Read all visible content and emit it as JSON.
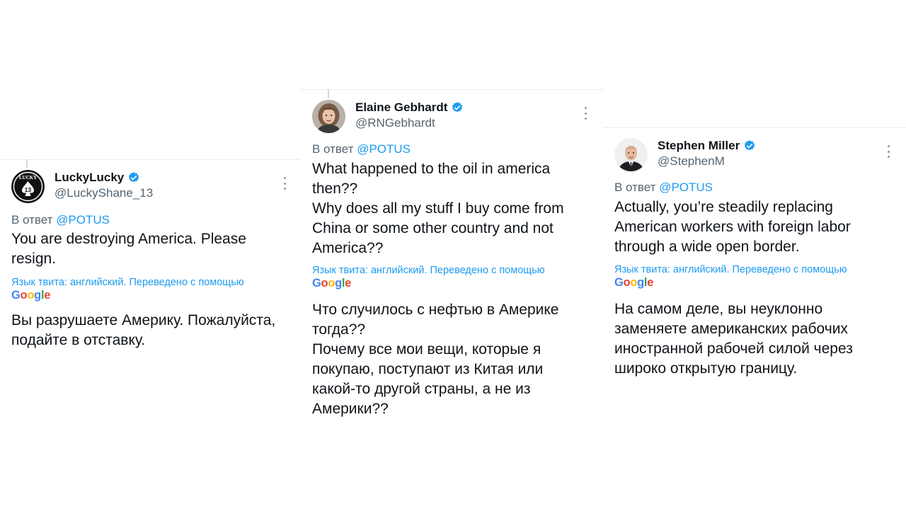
{
  "reply_prefix": "В ответ",
  "reply_mention": "@POTUS",
  "translation_label": "Язык твита: английский. Переведено с помощью",
  "google_logo": {
    "letters": [
      "G",
      "o",
      "o",
      "g",
      "l",
      "e"
    ],
    "colors": [
      "#4285F4",
      "#EA4335",
      "#FBBC05",
      "#4285F4",
      "#34A853",
      "#EA4335"
    ]
  },
  "colors": {
    "link": "#1d9bf0",
    "muted": "#536471",
    "text": "#0f1419"
  },
  "tweets": [
    {
      "display_name": "LuckyLucky",
      "handle": "@LuckyShane_13",
      "avatar_icon": "lucky-13-logo-icon",
      "avatar_text": "LUCKY",
      "avatar_number": "13",
      "text": "You are destroying America. Please\nresign.",
      "translation": "Вы разрушаете Америку. Пожалуйста,\nподайте в отставку."
    },
    {
      "display_name": "Elaine Gebhardt",
      "handle": "@RNGebhardt",
      "avatar_icon": "woman-portrait-icon",
      "text": "What happened to the oil in america\nthen??\nWhy does all my stuff I buy come from\nChina or some other country and not\nAmerica??",
      "translation": "Что случилось с нефтью в Америке\nтогда??\nПочему все мои вещи, которые я\nпокупаю, поступают из Китая или\nкакой-то другой страны, а не из\nАмерики??"
    },
    {
      "display_name": "Stephen Miller",
      "handle": "@StephenM",
      "avatar_icon": "man-portrait-icon",
      "text": "Actually, you’re steadily replacing\nAmerican workers with foreign labor\nthrough a wide open border.",
      "translation": "На самом деле, вы неуклонно\nзаменяете американских рабочих\nиностранной рабочей силой через\nшироко открытую границу."
    }
  ]
}
